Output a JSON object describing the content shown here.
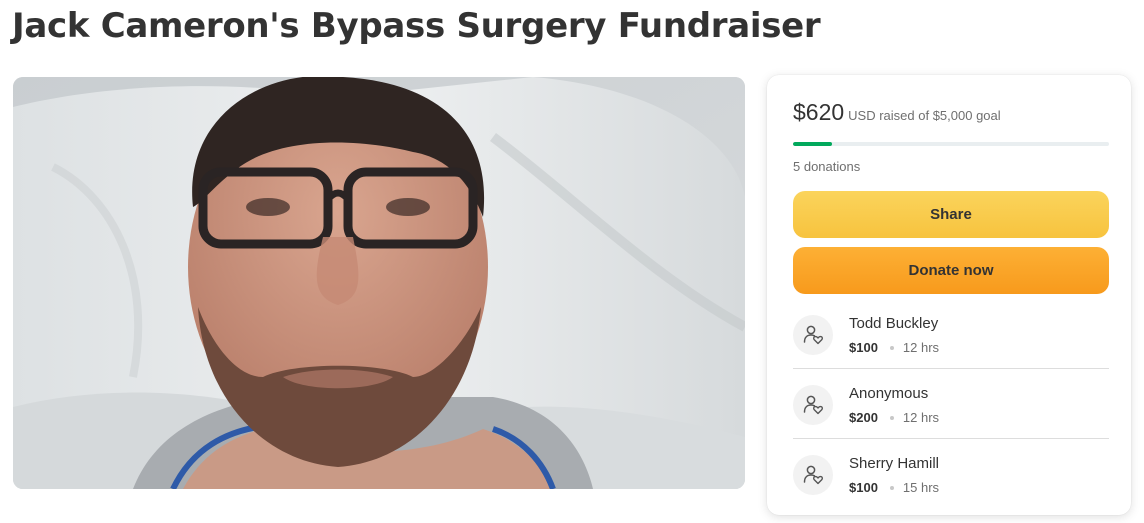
{
  "page": {
    "title": "Jack Cameron's Bypass Surgery Fundraiser"
  },
  "hero_image": {
    "description_icon": "campaign-photo"
  },
  "donate_card": {
    "amount_raised": "$620",
    "raised_suffix": "USD raised of $5,000 goal",
    "progress_fraction": 0.124,
    "donation_count": "5 donations",
    "share_label": "Share",
    "donate_label": "Donate now",
    "colors": {
      "progress": "#02a95c",
      "share_button": "#f8c744",
      "donate_button": "#f9a52a"
    }
  },
  "donations": [
    {
      "name": "Todd Buckley",
      "amount": "$100",
      "time": "12 hrs",
      "icon": "donor-heart-icon"
    },
    {
      "name": "Anonymous",
      "amount": "$200",
      "time": "12 hrs",
      "icon": "donor-heart-icon"
    },
    {
      "name": "Sherry Hamill",
      "amount": "$100",
      "time": "15 hrs",
      "icon": "donor-heart-icon"
    }
  ]
}
